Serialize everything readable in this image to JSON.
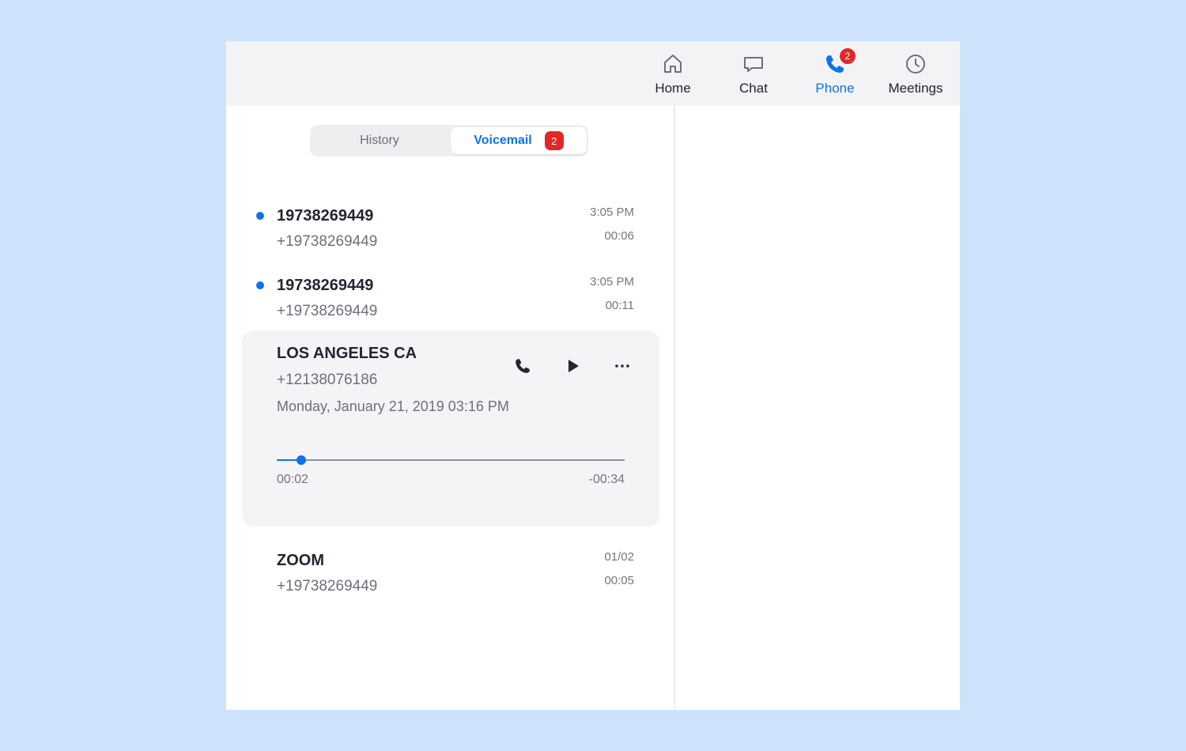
{
  "nav": {
    "items": [
      {
        "label": "Home",
        "icon": "home-icon"
      },
      {
        "label": "Chat",
        "icon": "chat-icon"
      },
      {
        "label": "Phone",
        "icon": "phone-icon",
        "badge": "2",
        "active": true
      },
      {
        "label": "Meetings",
        "icon": "clock-icon"
      }
    ]
  },
  "tabs": {
    "history": "History",
    "voicemail": "Voicemail",
    "voicemail_badge": "2"
  },
  "voicemails": [
    {
      "name": "19738269449",
      "number": "+19738269449",
      "time": "3:05 PM",
      "duration": "00:06",
      "unread": true
    },
    {
      "name": "19738269449",
      "number": "+19738269449",
      "time": "3:05 PM",
      "duration": "00:11",
      "unread": true
    },
    {
      "name": "LOS ANGELES  CA",
      "number": "+12138076186",
      "date": "Monday, January 21, 2019 03:16 PM",
      "playback": {
        "elapsed": "00:02",
        "remaining": "-00:34",
        "progress": 0.07
      }
    },
    {
      "name": "ZOOM",
      "number": "+19738269449",
      "time": "01/02",
      "duration": "00:05",
      "unread": false
    }
  ],
  "colors": {
    "accent": "#0e72ed",
    "badge": "#e02828",
    "background": "#cfe2fb"
  }
}
